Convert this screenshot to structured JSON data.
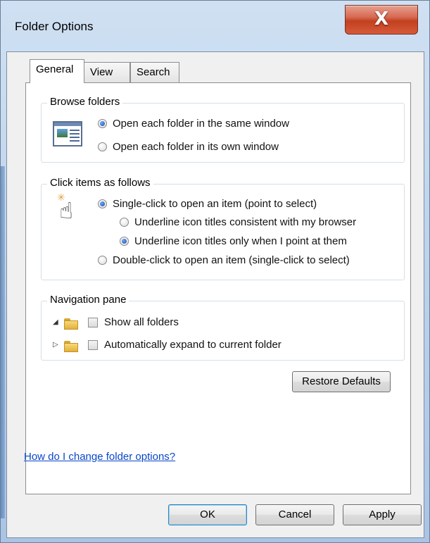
{
  "window": {
    "title": "Folder Options",
    "close_glyph": "X"
  },
  "tabs": [
    {
      "label": "General",
      "active": true
    },
    {
      "label": "View",
      "active": false
    },
    {
      "label": "Search",
      "active": false
    }
  ],
  "browse_folders": {
    "label": "Browse folders",
    "options": [
      {
        "label": "Open each folder in the same window",
        "checked": true
      },
      {
        "label": "Open each folder in its own window",
        "checked": false
      }
    ]
  },
  "click_items": {
    "label": "Click items as follows",
    "single_click": {
      "label": "Single-click to open an item (point to select)",
      "checked": true
    },
    "underline_browser": {
      "label": "Underline icon titles consistent with my browser",
      "checked": false
    },
    "underline_point": {
      "label": "Underline icon titles only when I point at them",
      "checked": true
    },
    "double_click": {
      "label": "Double-click to open an item (single-click to select)",
      "checked": false
    }
  },
  "navigation_pane": {
    "label": "Navigation pane",
    "show_all_folders": {
      "label": "Show all folders",
      "checked": false
    },
    "auto_expand": {
      "label": "Automatically expand to current folder",
      "checked": false
    }
  },
  "buttons": {
    "restore_defaults": "Restore Defaults",
    "ok": "OK",
    "cancel": "Cancel",
    "apply": "Apply"
  },
  "help_link": "How do I change folder options?",
  "icons": {
    "close": "close-icon",
    "browse": "folder-window-icon",
    "click": "hand-pointer-icon",
    "tree_expanded": "tree-expanded-arrow-icon",
    "tree_collapsed": "tree-collapsed-arrow-icon",
    "folder": "folder-icon"
  },
  "colors": {
    "link": "#0a46c9",
    "close_button": "#c2401f",
    "radio_dot": "#1b4fa8"
  }
}
